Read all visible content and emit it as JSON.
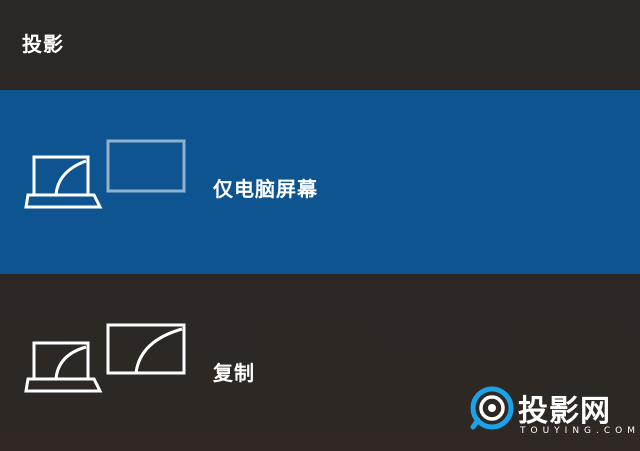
{
  "header": {
    "title": "投影"
  },
  "options": [
    {
      "label": "仅电脑屏幕",
      "icon": "pc-screen-only-icon",
      "selected": true
    },
    {
      "label": "复制",
      "icon": "duplicate-icon",
      "selected": false
    }
  ],
  "watermark": {
    "name": "投影网",
    "domain": "TOUYING.COM"
  },
  "colors": {
    "selected": "#0e5490",
    "background": "#2b2826",
    "brand": "#1aa3e8"
  }
}
